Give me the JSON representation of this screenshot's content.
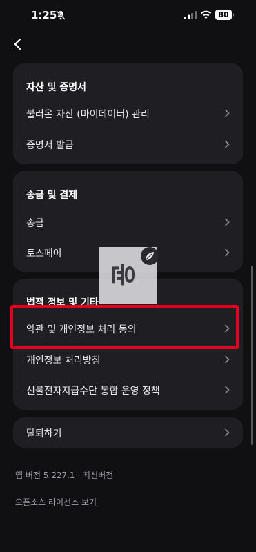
{
  "status_bar": {
    "time": "1:25",
    "battery": "80"
  },
  "sections": {
    "assets": {
      "title": "자산 및 증명서",
      "items": [
        "불러온 자산 (마이데이터) 관리",
        "증명서 발급"
      ]
    },
    "transfer": {
      "title": "송금 및 결제",
      "items": [
        "송금",
        "토스페이"
      ]
    },
    "legal": {
      "title": "법적 정보 및 기타",
      "items": [
        "약관 및 개인정보 처리 동의",
        "개인정보 처리방침",
        "선불전자지급수단 통합 운영 정책"
      ]
    },
    "withdraw": {
      "label": "탈퇴하기"
    }
  },
  "footer": {
    "version": "앱 버전 5.227.1 · 최신버전",
    "license_link": "오픈소스 라이선스 보기"
  },
  "watermark": {
    "text": "윤"
  },
  "colors": {
    "background": "#101013",
    "card": "#1f1f23",
    "highlight": "#e4001c"
  }
}
